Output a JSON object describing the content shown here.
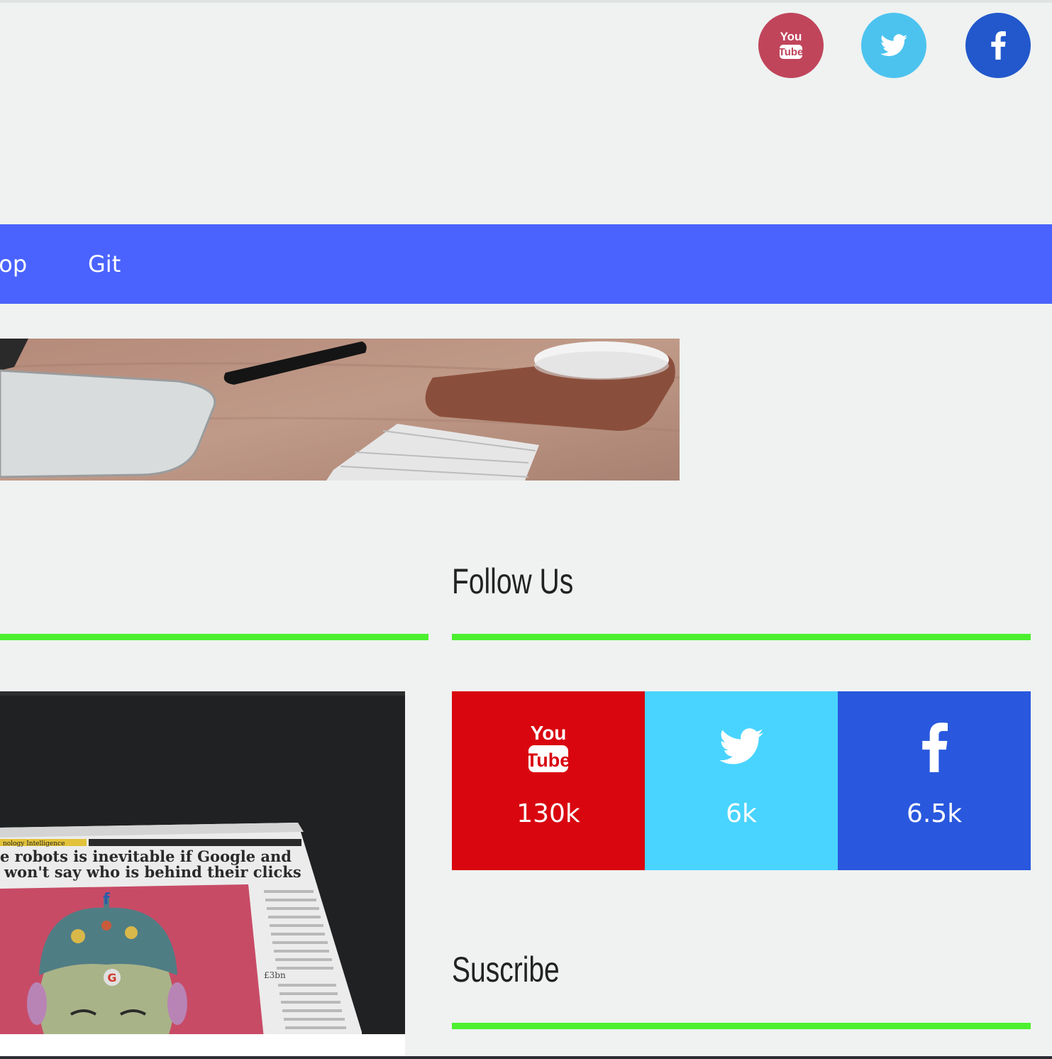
{
  "header": {
    "social": [
      {
        "name": "youtube",
        "icon": "youtube-icon",
        "color": "#c0455b"
      },
      {
        "name": "twitter",
        "icon": "twitter-icon",
        "color": "#4cc3ef"
      },
      {
        "name": "facebook",
        "icon": "facebook-icon",
        "color": "#2258cc"
      }
    ]
  },
  "nav": {
    "background": "#4a63ff",
    "items": [
      {
        "label": "hop"
      },
      {
        "label": "Git"
      }
    ]
  },
  "hero": {
    "icon": "desk-keyboard-mouse-photo"
  },
  "accent_color": "#4cf02f",
  "follow": {
    "title": "Follow Us",
    "items": [
      {
        "network": "youtube",
        "icon": "youtube-icon",
        "count": "130k",
        "color": "#d9060f"
      },
      {
        "network": "twitter",
        "icon": "twitter-icon",
        "count": "6k",
        "color": "#49d4ff"
      },
      {
        "network": "facebook",
        "icon": "facebook-icon",
        "count": "6.5k",
        "color": "#2958de"
      }
    ]
  },
  "subscribe": {
    "title": "Suscribe"
  },
  "card": {
    "icon": "newspaper-photo",
    "headline_line1": "e robots is inevitable if Google and",
    "headline_line2": "won't say who is behind their clicks",
    "tag": "nology Intelligence",
    "price": "£3bn"
  }
}
